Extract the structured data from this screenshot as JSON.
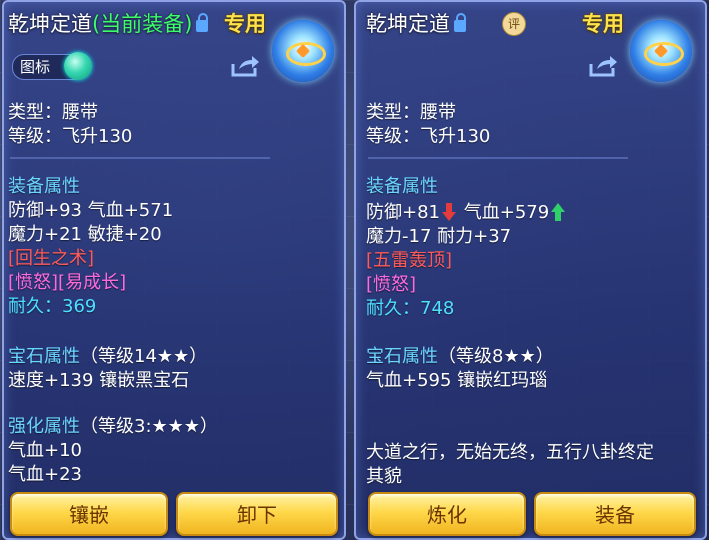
{
  "left_panel": {
    "title": "乾坤定道",
    "title_status": "(当前装备)",
    "exclusive": "专用",
    "toggle_label": "图标",
    "type_line": "类型：腰带",
    "level_line": "等级：飞升130",
    "equip_attr_header": "装备属性",
    "attr_line_1": "防御+93 气血+571",
    "attr_line_2": "魔力+21 敏捷+20",
    "special_skill": "[回生之术]",
    "special_effect": "[愤怒][易成长]",
    "durability_label": "耐久：",
    "durability_value": "369",
    "gem_header": "宝石属性",
    "gem_level": "（等级14★★）",
    "gem_line": "速度+139 镶嵌黑宝石",
    "strengthen_header": "强化属性",
    "strengthen_level": "（等级3:★★★）",
    "strengthen_line_1": "气血+10",
    "strengthen_line_2": "气血+23",
    "button_1": "镶嵌",
    "button_2": "卸下"
  },
  "right_panel": {
    "title": "乾坤定道",
    "badge": "评",
    "exclusive": "专用",
    "type_line": "类型：腰带",
    "level_line": "等级：飞升130",
    "equip_attr_header": "装备属性",
    "attr_1a": "防御+81",
    "attr_1b": "气血+579",
    "attr_line_2": "魔力-17 耐力+37",
    "special_skill": "[五雷轰顶]",
    "special_effect": "[愤怒]",
    "durability_label": "耐久：",
    "durability_value": "748",
    "gem_header": "宝石属性",
    "gem_level": "（等级8★★）",
    "gem_line": "气血+595 镶嵌红玛瑙",
    "description_1": "大道之行，无始无终，五行八卦终定",
    "description_2": "其貌",
    "button_1": "炼化",
    "button_2": "装备"
  },
  "colors": {
    "section_header": "#6bd6ff",
    "skill_red": "#ff5a5a",
    "effect_pink": "#ff6adf",
    "durability_cyan": "#4de0ff",
    "exclusive_gold": "#ffe14a",
    "status_green": "#3cff6a",
    "button_gold": "#ffd84a"
  },
  "icons": {
    "lock": "lock-icon",
    "share": "share-icon",
    "item": "belt-item-icon",
    "down": "arrow-down-icon",
    "up": "arrow-up-icon"
  }
}
